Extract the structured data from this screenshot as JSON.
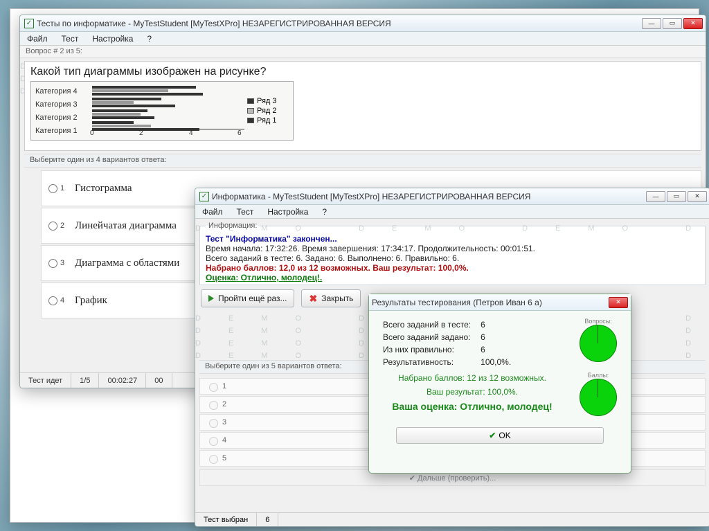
{
  "colors": {
    "accent_green": "#0bd30b",
    "close_red": "#d22"
  },
  "win1": {
    "title": "Тесты по информатике - MyTestStudent [MyTestXPro] НЕЗАРЕГИСТРИРОВАННАЯ ВЕРСИЯ",
    "menu": [
      "Файл",
      "Тест",
      "Настройка",
      "?"
    ],
    "progress": "Вопрос # 2 из 5:",
    "question": "Какой тип диаграммы изображен на рисунке?",
    "hint": "Выберите один из 4 вариантов ответа:",
    "chart": {
      "categories": [
        "Категория 4",
        "Категория 3",
        "Категория 2",
        "Категория 1"
      ],
      "legend": [
        "Ряд 3",
        "Ряд 2",
        "Ряд 1"
      ],
      "axis_ticks": [
        "0",
        "2",
        "4",
        "6"
      ]
    },
    "answers": [
      {
        "num": "1",
        "text": "Гистограмма"
      },
      {
        "num": "2",
        "text": "Линейчатая диаграмма"
      },
      {
        "num": "3",
        "text": "Диаграмма с областями"
      },
      {
        "num": "4",
        "text": "График"
      }
    ],
    "status": {
      "state": "Тест идет",
      "counter": "1/5",
      "elapsed": "00:02:27",
      "extra": "00"
    }
  },
  "win2": {
    "title": "Информатика - MyTestStudent [MyTestXPro] НЕЗАРЕГИСТРИРОВАННАЯ ВЕРСИЯ",
    "menu": [
      "Файл",
      "Тест",
      "Настройка",
      "?"
    ],
    "info_header": "Информация:",
    "info": {
      "line1": "Тест \"Информатика\" закончен...",
      "line2": "Время начала: 17:32:26. Время завершения: 17:34:17. Продолжительность: 00:01:51.",
      "line3": "Всего заданий в тесте: 6. Задано: 6. Выполнено: 6. Правильно: 6.",
      "line4": "Набрано баллов: 12,0 из 12 возможных. Ваш результат: 100,0%.",
      "line5": "Оценка: Отлично, молодец!."
    },
    "buttons": {
      "retry": "Пройти ещё раз...",
      "close": "Закрыть"
    },
    "hint": "Выберите один из 5 вариантов ответа:",
    "empty_n": [
      "1",
      "2",
      "3",
      "4",
      "5"
    ],
    "next": "✔ Дальше (проверить)...",
    "status": {
      "state": "Тест выбран",
      "counter": "6"
    }
  },
  "dlg": {
    "title": "Результаты тестирования (Петров Иван 6 а)",
    "rows": [
      {
        "k": "Всего заданий в тесте:",
        "v": "6"
      },
      {
        "k": "Всего заданий задано:",
        "v": "6"
      },
      {
        "k": "Из них правильно:",
        "v": "6"
      },
      {
        "k": "Результативность:",
        "v": "100,0%."
      }
    ],
    "score1": "Набрано баллов: 12 из 12 возможных.",
    "score2": "Ваш результат: 100,0%.",
    "grade": "Ваша оценка: Отлично, молодец!",
    "pies": [
      "Вопросы:",
      "Баллы:"
    ],
    "ok": "OK"
  },
  "watermark": "DEMO"
}
